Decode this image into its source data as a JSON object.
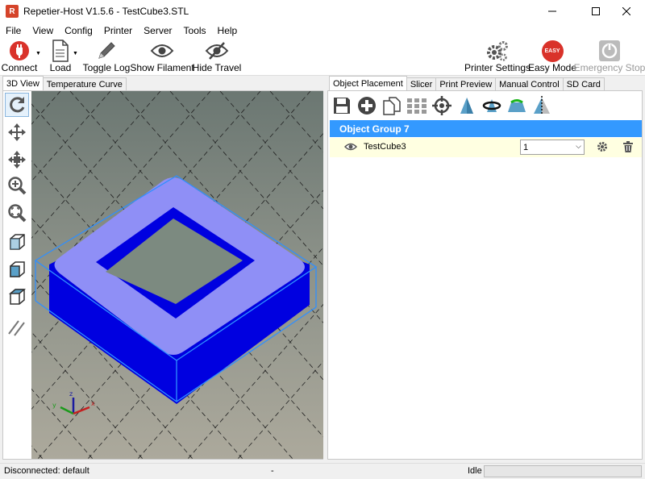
{
  "window": {
    "title": "Repetier-Host V1.5.6 - TestCube3.STL",
    "app_icon_letter": "R"
  },
  "menu": [
    "File",
    "View",
    "Config",
    "Printer",
    "Server",
    "Tools",
    "Help"
  ],
  "toolbar": {
    "connect": "Connect",
    "load": "Load",
    "toggle_log": "Toggle Log",
    "show_filament": "Show Filament",
    "hide_travel": "Hide Travel",
    "printer_settings": "Printer Settings",
    "easy_mode": "Easy Mode",
    "easy_badge": "EASY",
    "emergency_stop": "Emergency Stop"
  },
  "left_tabs": [
    "3D View",
    "Temperature Curve"
  ],
  "right_tabs": [
    "Object Placement",
    "Slicer",
    "Print Preview",
    "Manual Control",
    "SD Card"
  ],
  "object_group": "Object Group 7",
  "object": {
    "name": "TestCube3",
    "copies": "1"
  },
  "status": {
    "connection": "Disconnected: default",
    "middle": "-",
    "state": "Idle"
  },
  "colors": {
    "accent": "#3399ff",
    "model": "#0000e0",
    "model_top": "#8f8ff6",
    "selection": "#2f8fff",
    "row_highlight": "#ffffe1"
  }
}
